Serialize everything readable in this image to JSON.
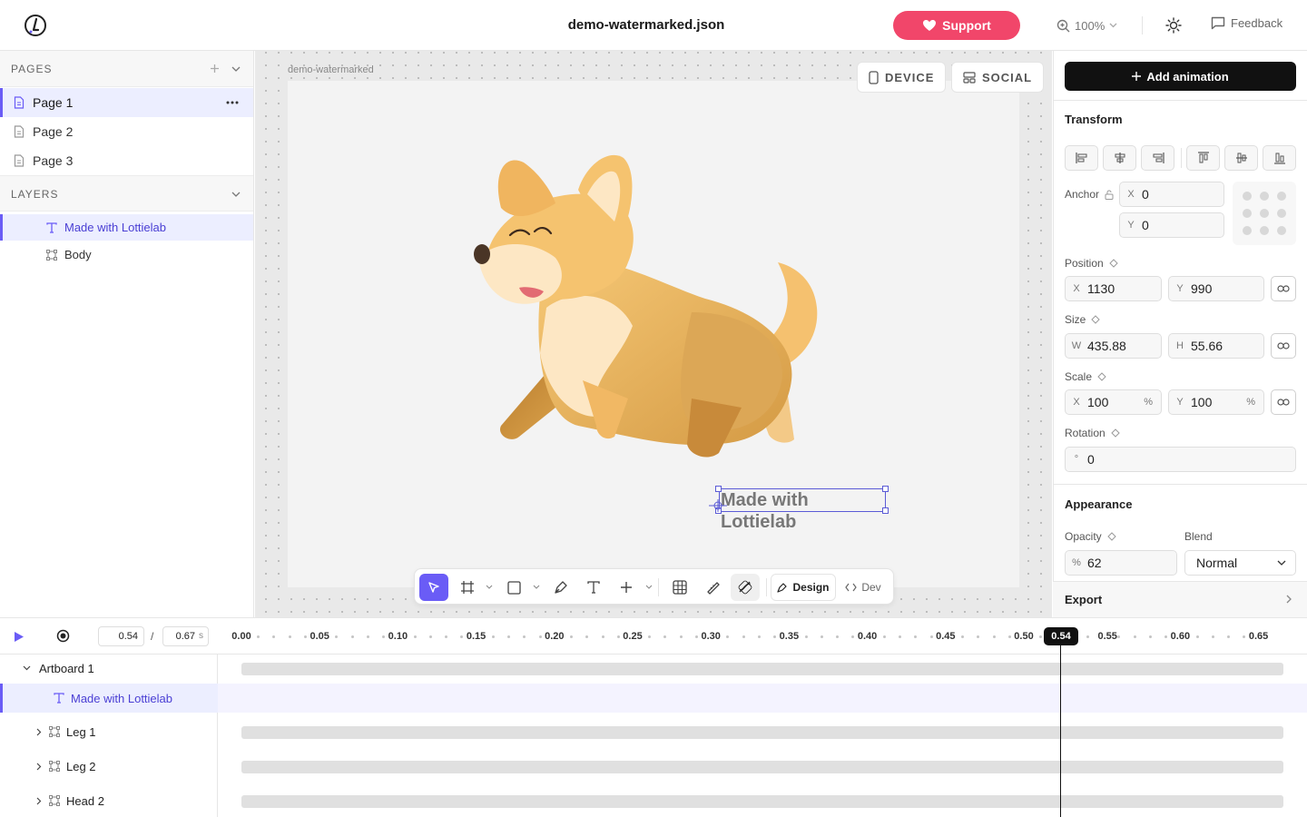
{
  "header": {
    "title": "demo-watermarked.json",
    "support_label": "Support",
    "zoom": "100%",
    "feedback_label": "Feedback"
  },
  "pages": {
    "heading": "PAGES",
    "items": [
      "Page 1",
      "Page 2",
      "Page 3"
    ],
    "selected": "Page 1"
  },
  "layers": {
    "heading": "LAYERS",
    "items": [
      "Made with Lottielab",
      "Body"
    ],
    "selected": "Made with Lottielab"
  },
  "canvas": {
    "artboard_label": "demo-watermarked",
    "device_label": "DEVICE",
    "social_label": "SOCIAL",
    "watermark_text": "Made with Lottielab",
    "mode_design": "Design",
    "mode_dev": "Dev"
  },
  "properties": {
    "add_animation": "Add animation",
    "transform_title": "Transform",
    "anchor_label": "Anchor",
    "anchor_x": "0",
    "anchor_y": "0",
    "position_label": "Position",
    "position_x": "1130",
    "position_y": "990",
    "size_label": "Size",
    "size_w": "435.88",
    "size_h": "55.66",
    "scale_label": "Scale",
    "scale_x": "100",
    "scale_y": "100",
    "rotation_label": "Rotation",
    "rotation": "0",
    "appearance_title": "Appearance",
    "opacity_label": "Opacity",
    "opacity": "62",
    "blend_label": "Blend",
    "blend": "Normal",
    "export_label": "Export",
    "prefix_x": "X",
    "prefix_y": "Y",
    "prefix_w": "W",
    "prefix_h": "H",
    "prefix_deg": "°",
    "prefix_pct": "%",
    "suffix_pct": "%"
  },
  "timeline": {
    "current_time": "0.54",
    "separator": "/",
    "duration": "0.67",
    "unit": "s",
    "playhead": "0.54",
    "ticks": [
      "0.00",
      "0.05",
      "0.10",
      "0.15",
      "0.20",
      "0.25",
      "0.30",
      "0.35",
      "0.40",
      "0.45",
      "0.50",
      "0.55",
      "0.60",
      "0.65"
    ],
    "layers": [
      "Artboard 1",
      "Made with Lottielab",
      "Leg 1",
      "Leg 2",
      "Head 2"
    ]
  },
  "colors": {
    "accent": "#6a5cf6",
    "support": "#f1466a",
    "selection": "#5b5bd6"
  }
}
